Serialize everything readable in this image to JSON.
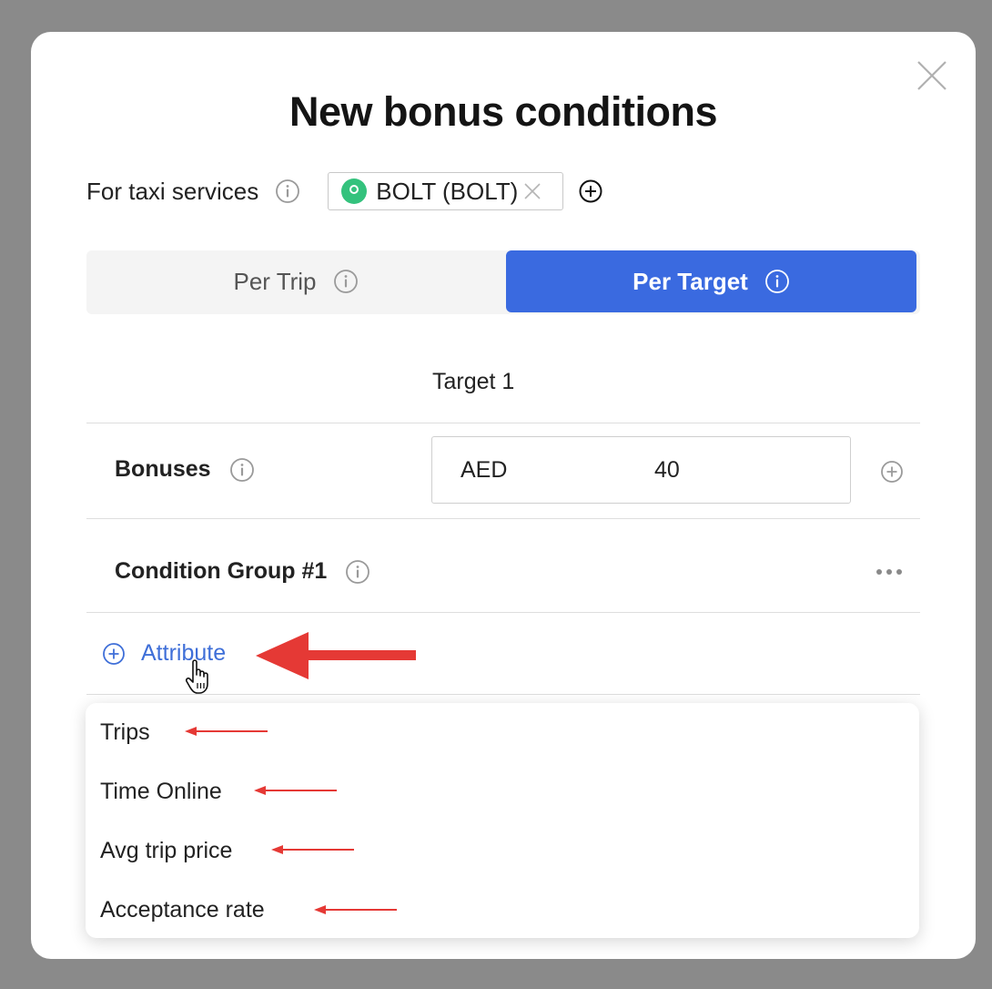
{
  "modal": {
    "title": "New bonus conditions",
    "services": {
      "label": "For taxi services",
      "chip_label": "BOLT (BOLT)"
    },
    "tabs": [
      {
        "label": "Per Trip",
        "selected": false
      },
      {
        "label": "Per Target",
        "selected": true
      }
    ],
    "target_header": "Target 1",
    "bonuses": {
      "label": "Bonuses",
      "currency": "AED",
      "amount": "40"
    },
    "condition_group": {
      "label": "Condition Group #1"
    },
    "add_attribute_label": "Attribute",
    "attribute_options": [
      "Trips",
      "Time Online",
      "Avg trip price",
      "Acceptance rate"
    ]
  },
  "colors": {
    "accent": "#3a6ae0",
    "link": "#3f6fd8",
    "annotation_arrow": "#e53935",
    "chip_logo": "#34c27d"
  },
  "icons": [
    "close-icon",
    "info-icon",
    "bolt-logo-icon",
    "chip-remove-icon",
    "plus-circle-icon",
    "more-icon",
    "hand-cursor-icon",
    "annotation-arrow"
  ]
}
